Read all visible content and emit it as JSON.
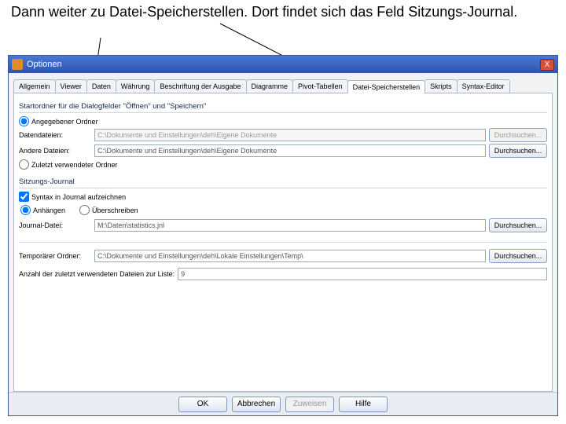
{
  "caption": "Dann weiter zu Datei-Speicherstellen. Dort findet sich das Feld Sitzungs-Journal.",
  "window": {
    "title": "Optionen",
    "close_x": "X"
  },
  "tabs": {
    "allgemein": "Allgemein",
    "viewer": "Viewer",
    "daten": "Daten",
    "waehrung": "Währung",
    "beschriftung": "Beschriftung der Ausgabe",
    "diagramme": "Diagramme",
    "pivottab": "Pivot-Tabellen",
    "dateispeicher": "Datei-Speicherstellen",
    "skripts": "Skripts",
    "syntax": "Syntax-Editor"
  },
  "grp1": {
    "title": "Startordner für die Dialogfelder \"Öffnen\" und \"Speichern\"",
    "radio_spec": "Angegebener Ordner",
    "lbl_data": "Datendateien:",
    "val_data": "C:\\Dokumente und Einstellungen\\deh\\Eigene Dokumente",
    "lbl_other": "Andere Dateien:",
    "val_other": "C:\\Dokumente und Einstellungen\\deh\\Eigene Dokumente",
    "radio_recent": "Zuletzt verwendeter Ordner",
    "browse": "Durchsuchen..."
  },
  "grp2": {
    "title": "Sitzungs-Journal",
    "chk_record": "Syntax in Journal aufzeichnen",
    "radio_append": "Anhängen",
    "radio_overwrite": "Überschreiben",
    "lbl_file": "Journal-Datei:",
    "val_file": "M:\\Daten\\statistics.jnl",
    "browse": "Durchsuchen..."
  },
  "grp3": {
    "lbl_temp": "Temporärer Ordner:",
    "val_temp": "C:\\Dokumente und Einstellungen\\deh\\Lokale Einstellungen\\Temp\\",
    "browse": "Durchsuchen...",
    "lbl_recent": "Anzahl der zuletzt verwendeten Dateien zur Liste:",
    "val_recent": "9"
  },
  "buttons": {
    "ok": "OK",
    "cancel": "Abbrechen",
    "apply": "Zuweisen",
    "help": "Hilfe"
  }
}
